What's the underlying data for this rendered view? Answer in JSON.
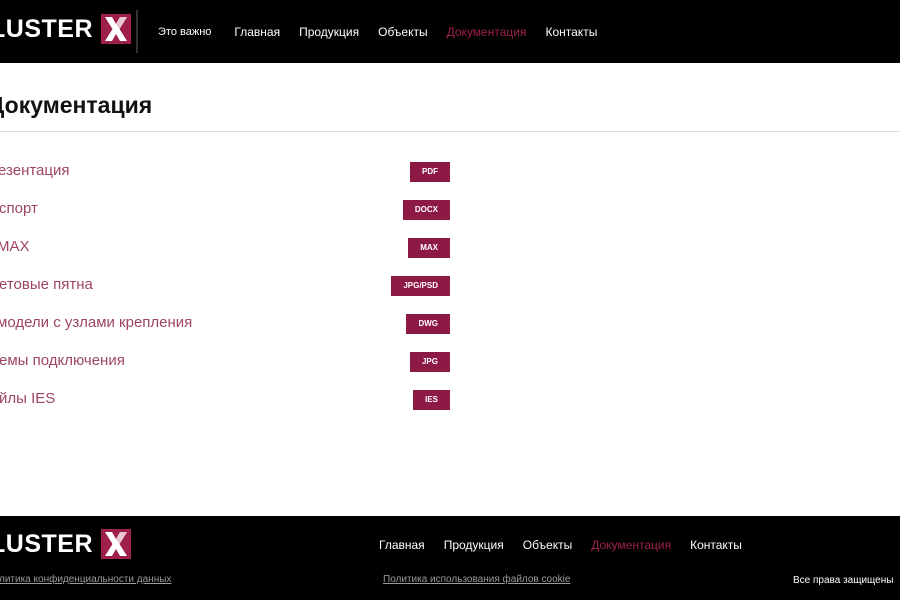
{
  "header": {
    "logo_text": "LUSTER",
    "nav": [
      {
        "label": "Это важно"
      },
      {
        "label": "Главная"
      },
      {
        "label": "Продукция"
      },
      {
        "label": "Объекты"
      },
      {
        "label": "Документация"
      },
      {
        "label": "Контакты"
      }
    ],
    "active_index": 4
  },
  "main": {
    "title": "Документация",
    "documents": [
      {
        "name": "езентация",
        "format": "PDF"
      },
      {
        "name": "спорт",
        "format": "DOCX"
      },
      {
        "name": "MAX",
        "format": "MAX"
      },
      {
        "name": "етовые пятна",
        "format": "JPG/PSD"
      },
      {
        "name": "модели с узлами крепления",
        "format": "DWG"
      },
      {
        "name": "емы подключения",
        "format": "JPG"
      },
      {
        "name": "йлы IES",
        "format": "IES"
      }
    ]
  },
  "footer": {
    "logo_text": "LUSTER",
    "nav": [
      {
        "label": "Главная"
      },
      {
        "label": "Продукция"
      },
      {
        "label": "Объекты"
      },
      {
        "label": "Документация"
      },
      {
        "label": "Контакты"
      }
    ],
    "privacy_policy": "литика конфиденциальности данных",
    "cookie_policy": "Политика использования файлов cookie",
    "rights": "Все права защищены"
  },
  "colors": {
    "accent": "#9e1f4b",
    "badge": "#8c1a45",
    "doc_link": "#9e4465",
    "header_bg": "#000000"
  }
}
